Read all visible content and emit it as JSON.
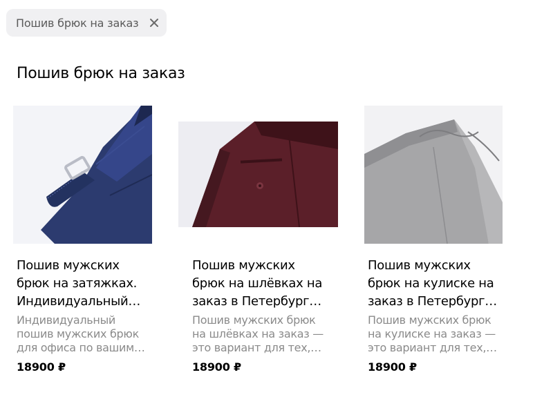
{
  "filter_chip": {
    "label": "Пошив брюк на заказ",
    "icon": "close-icon"
  },
  "section": {
    "title": "Пошив брюк на заказ"
  },
  "products": [
    {
      "title_lines": [
        "Пошив мужских",
        "брюк на затяжках.",
        "Индивидуальный…"
      ],
      "desc_lines": [
        "Индивидуальный",
        "пошив мужских брюк",
        "для офиса по вашим…"
      ],
      "price": "18900 ₽",
      "image": "navy-trousers-side-adjuster-image"
    },
    {
      "title_lines": [
        "Пошив мужских",
        "брюк на шлёвках на",
        "заказ в Петербург…"
      ],
      "desc_lines": [
        "Пошив мужских брюк",
        "на шлёвках на заказ —",
        "это вариант для тех,…"
      ],
      "price": "18900 ₽",
      "image": "burgundy-trousers-back-pocket-image"
    },
    {
      "title_lines": [
        "Пошив мужских",
        "брюк на кулиске на",
        "заказ в Петербург…"
      ],
      "desc_lines": [
        "Пошив мужских брюк",
        "на кулиске на заказ —",
        "это вариант для тех,…"
      ],
      "price": "18900 ₽",
      "image": "grey-trousers-drawstring-image"
    }
  ],
  "colors": {
    "chip_bg": "#f0f0f2",
    "desc_text": "#8a8a8a",
    "navy": "#2b3a6e",
    "burgundy": "#5a1f28",
    "grey": "#a9a9a9"
  }
}
